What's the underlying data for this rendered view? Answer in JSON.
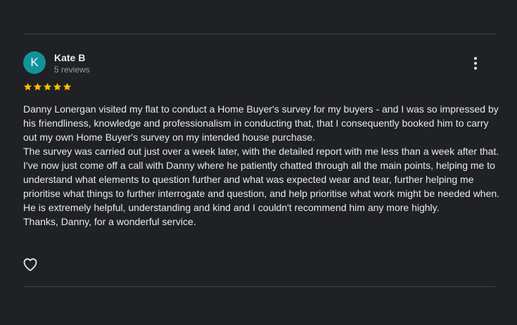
{
  "review": {
    "avatar_initial": "K",
    "reviewer_name": "Kate B",
    "review_count": "5 reviews",
    "rating": 5,
    "paragraphs": [
      "Danny Lonergan visited my flat to conduct a Home Buyer's survey for my buyers - and I was so impressed by his friendliness, knowledge and professionalism in conducting that, that I consequently booked him to carry out my own Home Buyer's survey on my intended house purchase.",
      "The survey was carried out just over a week later, with the detailed report with me less than a week after that. I've now just come off a call with Danny where he patiently chatted through all the main points, helping me to understand what elements to question further and what was expected wear and tear, further helping me prioritise what things to further interrogate and question, and help prioritise what work might be needed when.",
      "He is extremely helpful, understanding and kind and I couldn't recommend him any more highly.",
      "Thanks, Danny, for a wonderful service."
    ]
  },
  "icons": {
    "more": "more-vert-icon",
    "like": "heart-outline-icon",
    "star": "star-icon"
  },
  "colors": {
    "background": "#202124",
    "avatar": "#12939a",
    "star": "#fbbc04",
    "text": "#e8eaed",
    "secondary_text": "#9aa0a6",
    "divider": "#3c4043"
  }
}
